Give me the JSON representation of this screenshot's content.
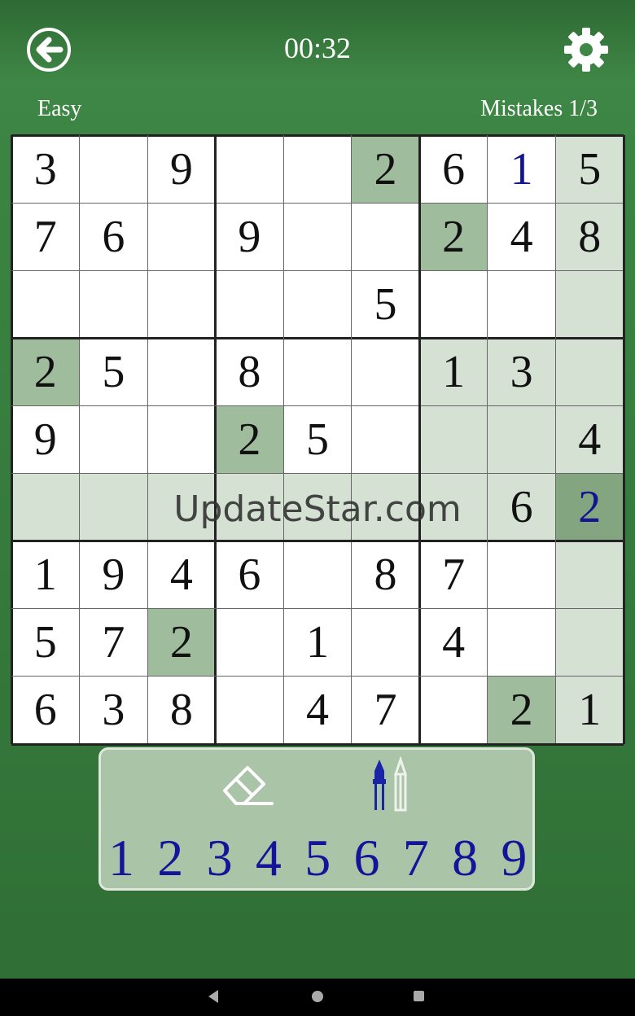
{
  "header": {
    "timer": "00:32",
    "difficulty": "Easy",
    "mistakes": "Mistakes 1/3"
  },
  "icons": {
    "back": "arrow-left-circle-icon",
    "settings": "gear-icon",
    "eraser": "eraser-icon",
    "pen": "pen-pencil-icon"
  },
  "colors": {
    "accent_green": "#3c8544",
    "user_digit": "#12158f",
    "highlight": "#d5e2d3",
    "same_digit": "#9fbc9d",
    "selected": "#83a680"
  },
  "board": {
    "rows": [
      [
        "3",
        "",
        "9",
        "",
        "",
        "2",
        "6",
        "1",
        "5"
      ],
      [
        "7",
        "6",
        "",
        "9",
        "",
        "",
        "2",
        "4",
        "8"
      ],
      [
        "",
        "",
        "",
        "",
        "",
        "5",
        "",
        "",
        ""
      ],
      [
        "2",
        "5",
        "",
        "8",
        "",
        "",
        "1",
        "3",
        ""
      ],
      [
        "9",
        "",
        "",
        "2",
        "5",
        "",
        "",
        "",
        "4"
      ],
      [
        "",
        "",
        "",
        "",
        "",
        "",
        "",
        "6",
        "2"
      ],
      [
        "1",
        "9",
        "4",
        "6",
        "",
        "8",
        "7",
        "",
        ""
      ],
      [
        "5",
        "7",
        "2",
        "",
        "1",
        "",
        "4",
        "",
        ""
      ],
      [
        "6",
        "3",
        "8",
        "",
        "4",
        "7",
        "",
        "2",
        "1"
      ]
    ],
    "user_entered": [
      [
        0,
        7
      ],
      [
        5,
        8
      ]
    ],
    "selected": [
      5,
      8
    ],
    "same_value": [
      [
        0,
        5
      ],
      [
        1,
        6
      ],
      [
        3,
        0
      ],
      [
        4,
        3
      ],
      [
        7,
        2
      ],
      [
        8,
        7
      ]
    ]
  },
  "watermark": "UpdateStar.com",
  "number_pad": [
    "1",
    "2",
    "3",
    "4",
    "5",
    "6",
    "7",
    "8",
    "9"
  ]
}
